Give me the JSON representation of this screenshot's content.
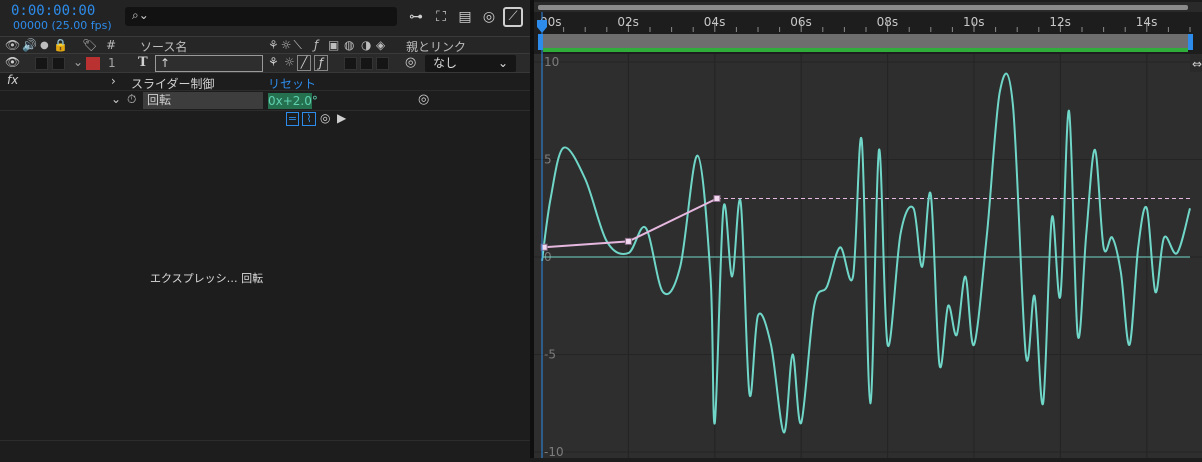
{
  "header": {
    "timecode": "0:00:00:00",
    "frame_fps": "00000 (25.00 fps)",
    "search_icon": "search-icon"
  },
  "columns": {
    "number": "#",
    "source_name": "ソース名",
    "parent_link": "親とリンク"
  },
  "layer": {
    "number": "1",
    "type_glyph": "T",
    "name": "↑",
    "label_color": "#b93131",
    "parent_value": "なし"
  },
  "effect": {
    "fx_label": "fx",
    "name": "スライダー制御",
    "reset_label": "リセット"
  },
  "property": {
    "name": "回転",
    "value": "0x+2.0°"
  },
  "expression_label": "エクスプレッシ… 回転",
  "timeline": {
    "ruler_labels": [
      "00s",
      "02s",
      "04s",
      "06s",
      "08s",
      "10s",
      "12s",
      "14s"
    ],
    "y_labels": [
      "10",
      "5",
      "0",
      "-5",
      "-10"
    ],
    "work_area_color": "#2fae3b",
    "playhead_color": "#2d8ceb"
  },
  "chart_data": {
    "type": "line",
    "x_range": [
      0,
      15
    ],
    "y_range": [
      -10,
      10
    ],
    "grid": true,
    "series": [
      {
        "color": "#6fd6c8",
        "x": [
          0,
          0.2,
          0.5,
          1.0,
          1.5,
          2.0,
          2.4,
          2.8,
          3.2,
          3.6,
          3.9,
          4.0,
          4.2,
          4.4,
          4.6,
          4.8,
          5.0,
          5.3,
          5.6,
          5.8,
          6.0,
          6.3,
          6.6,
          6.9,
          7.2,
          7.4,
          7.6,
          7.8,
          8.0,
          8.3,
          8.6,
          8.8,
          9.0,
          9.2,
          9.4,
          9.6,
          9.8,
          10.0,
          10.3,
          10.6,
          10.9,
          11.2,
          11.4,
          11.6,
          11.8,
          12.0,
          12.2,
          12.4,
          12.6,
          12.8,
          13.0,
          13.2,
          13.4,
          13.6,
          13.8,
          14.0,
          14.2,
          14.4,
          14.7,
          15.0
        ],
        "y": [
          -0.2,
          3.0,
          5.6,
          4.0,
          0.8,
          0.2,
          1.5,
          -1.8,
          -0.5,
          5.2,
          -1.0,
          -8.5,
          2.5,
          -1.0,
          2.8,
          -7.0,
          -3.0,
          -4.5,
          -9.0,
          -5.0,
          -8.5,
          -2.5,
          -1.5,
          0.5,
          -1.0,
          6.0,
          -7.5,
          5.5,
          -4.5,
          1.2,
          2.5,
          -0.5,
          3.2,
          -5.5,
          -2.5,
          -4.0,
          -1.0,
          -4.5,
          1.2,
          8.5,
          7.8,
          -5.0,
          -2.0,
          -7.5,
          2.0,
          -2.0,
          7.5,
          -4.0,
          1.2,
          5.5,
          0.5,
          1.0,
          -0.8,
          -4.5,
          0.5,
          2.5,
          -1.8,
          1.0,
          0.2,
          2.5
        ]
      },
      {
        "color": "#e6b8df",
        "x": [
          0.05,
          2.0,
          4.05
        ],
        "y": [
          0.5,
          0.8,
          3.0
        ]
      },
      {
        "color": "#e6b8df",
        "x": [
          4.05,
          15.0
        ],
        "y": [
          3.0,
          3.0
        ]
      },
      {
        "color": "#6fd6c8",
        "x": [
          0,
          15.0
        ],
        "y": [
          0,
          0
        ]
      }
    ]
  }
}
